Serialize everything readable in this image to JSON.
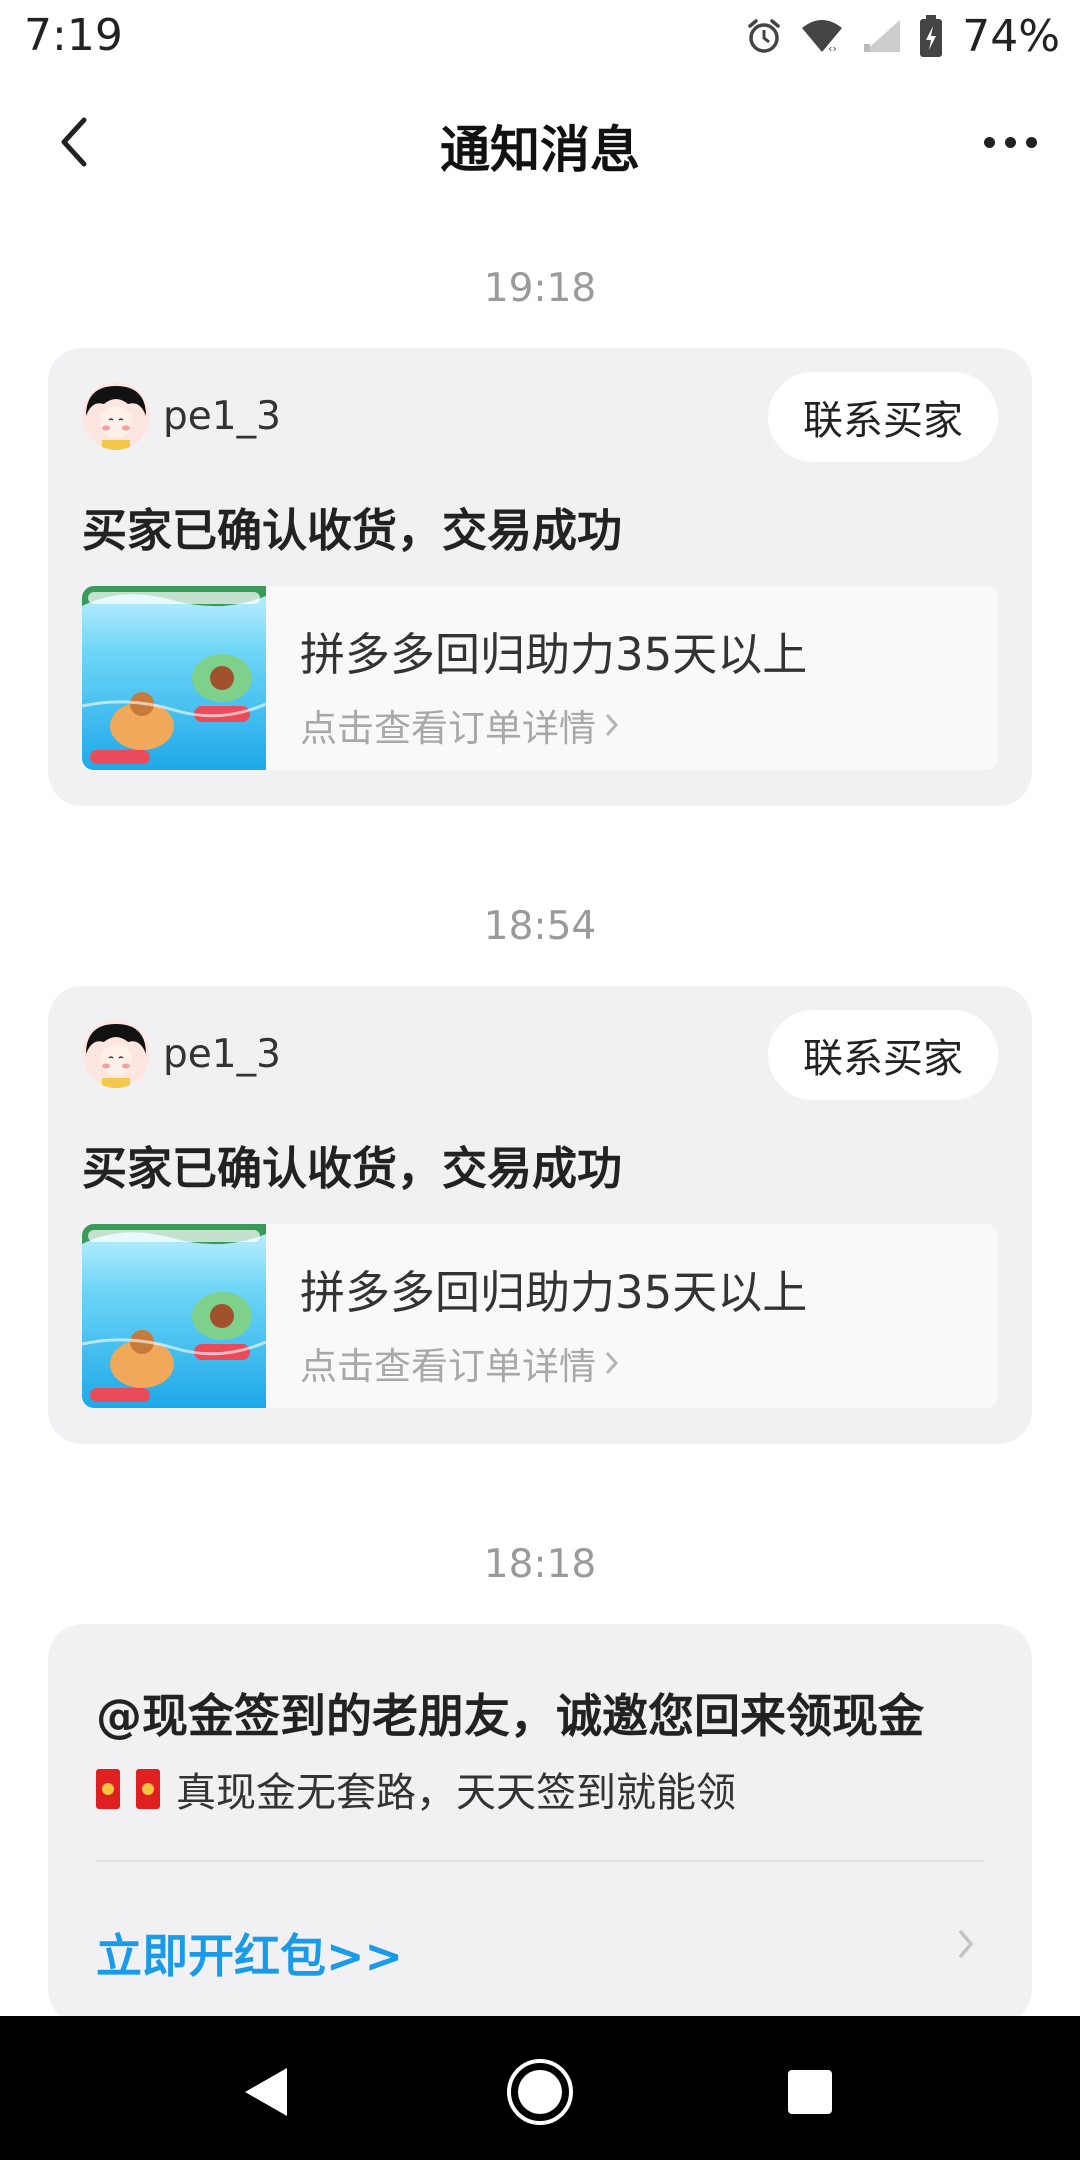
{
  "status_bar": {
    "time": "7:19",
    "battery": "74%"
  },
  "header": {
    "title": "通知消息"
  },
  "messages": [
    {
      "time": "19:18",
      "username": "pe1_3",
      "contact_label": "联系买家",
      "title": "买家已确认收货，交易成功",
      "item_name": "拼多多回归助力35天以上",
      "item_link": "点击查看订单详情"
    },
    {
      "time": "18:54",
      "username": "pe1_3",
      "contact_label": "联系买家",
      "title": "买家已确认收货，交易成功",
      "item_name": "拼多多回归助力35天以上",
      "item_link": "点击查看订单详情"
    }
  ],
  "promo": {
    "time": "18:18",
    "title": "@现金签到的老朋友，诚邀您回来领现金",
    "subtitle": "真现金无套路，天天签到就能领",
    "action": "立即开红包>>"
  },
  "colors": {
    "accent": "#1a9be8",
    "card_bg": "#f1f1f3",
    "red_envelope": "#e02020"
  }
}
